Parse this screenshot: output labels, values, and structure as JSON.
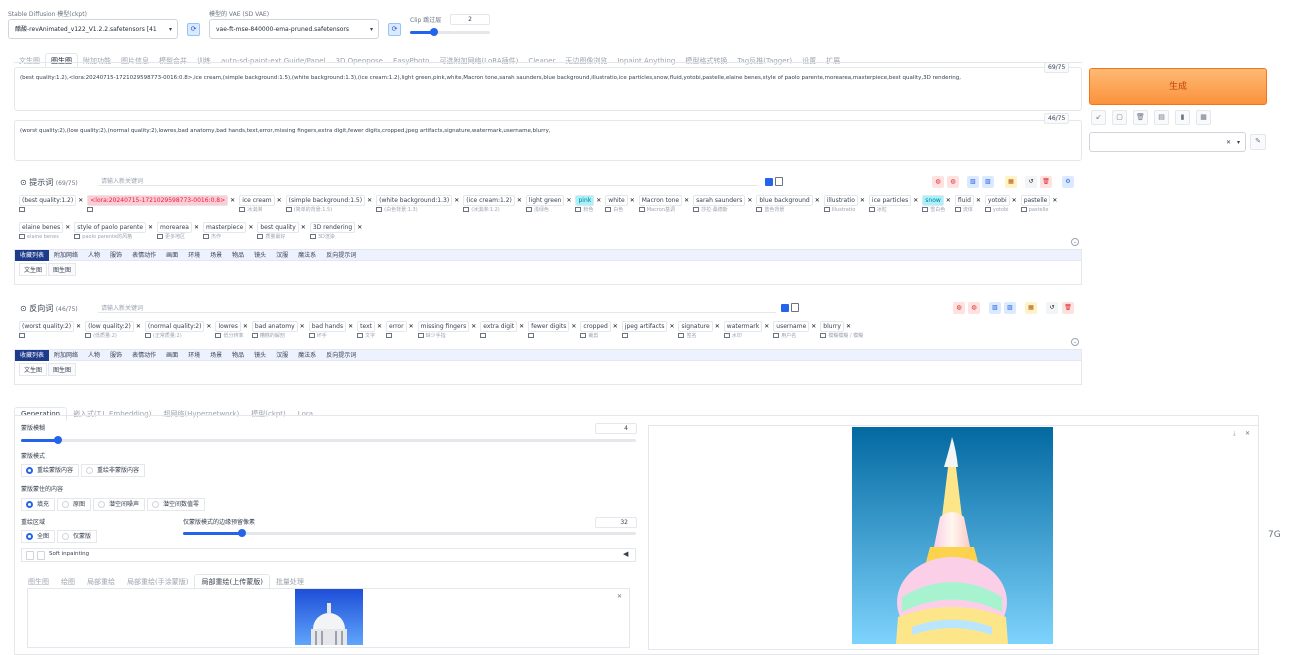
{
  "header": {
    "model_label": "Stable Diffusion 模型(ckpt)",
    "model_value": "醋酸-revAnimated_v122_V1.2.2.safetensors [41",
    "vae_label": "模型的 VAE (SD VAE)",
    "vae_value": "vae-ft-mse-840000-ema-pruned.safetensors",
    "clip_label": "Clip 跳过层",
    "clip_value": "2",
    "clip_fraction": 0.3
  },
  "tabs": [
    "文生图",
    "图生图",
    "附加功能",
    "图片信息",
    "模型合并",
    "训练",
    "auto-sd-paint-ext Guide/Panel",
    "3D Openpose",
    "EasyPhoto",
    "可选附加网络(LoRA插件)",
    "Cleaner",
    "无边图像浏览",
    "Inpaint Anything",
    "模型格式转换",
    "Tag反推(Tagger)",
    "设置",
    "扩展"
  ],
  "active_tab_index": 1,
  "prompt": {
    "text": "(best quality:1.2),<lora:20240715-1721029598773-0016:0.8>,ice cream,(simple background:1.5),(white background:1.3),(ice cream:1.2),light green,pink,white,Macron tone,sarah saunders,blue background,illustratio,ice particles,snow,fluid,yotobi,pastelle,elaine benes,style of paolo parente,morearea,masterpiece,best quality,3D rendering,",
    "count": "69/75"
  },
  "negative": {
    "text": "(worst quality:2),(low quality:2),(normal quality:2),lowres,bad anatomy,bad hands,text,error,missing fingers,extra digit,fewer digits,cropped,jpeg artifacts,signature,watermark,username,blurry,",
    "count": "46/75"
  },
  "generate_label": "生成",
  "prompt_section": {
    "title": "提示词",
    "count": "(69/75)",
    "search_placeholder": "请输入新关键词",
    "tags_row1": [
      {
        "t": "(best quality:1.2)",
        "tr": ""
      },
      {
        "t": "<lora:20240715-1721029598773-0016:0.8>",
        "tr": "",
        "cls": "pink"
      },
      {
        "t": "ice cream",
        "tr": "冰淇淋"
      },
      {
        "t": "(simple background:1.5)",
        "tr": "(简单的背景:1.5)"
      },
      {
        "t": "(white background:1.3)",
        "tr": "(白色背景:1.3)"
      },
      {
        "t": "(ice cream:1.2)",
        "tr": "(冰淇淋:1.2)"
      },
      {
        "t": "light green",
        "tr": "浅绿色"
      },
      {
        "t": "pink",
        "tr": "粉色",
        "cls": "cyan"
      },
      {
        "t": "white",
        "tr": "白色"
      },
      {
        "t": "Macron tone",
        "tr": "Macron基调"
      },
      {
        "t": "sarah saunders",
        "tr": "莎拉·桑德斯"
      },
      {
        "t": "blue background",
        "tr": "蓝色背景"
      },
      {
        "t": "illustratio",
        "tr": "Illustratio"
      },
      {
        "t": "ice particles",
        "tr": "冰粒"
      },
      {
        "t": "snow",
        "tr": "雪白色",
        "cls": "cyan"
      },
      {
        "t": "fluid",
        "tr": "流体"
      },
      {
        "t": "yotobi",
        "tr": "yotobi"
      },
      {
        "t": "pastelle",
        "tr": "pastelle"
      }
    ],
    "tags_row2": [
      {
        "t": "elaine benes",
        "tr": "elaine benes"
      },
      {
        "t": "style of paolo parente",
        "tr": "paolo parente的风格"
      },
      {
        "t": "morearea",
        "tr": "更多地区"
      },
      {
        "t": "masterpiece",
        "tr": "杰作"
      },
      {
        "t": "best quality",
        "tr": "质量最好"
      },
      {
        "t": "3D rendering",
        "tr": "3D渲染"
      }
    ]
  },
  "categories": [
    "收藏列表",
    "附加网络",
    "人物",
    "服饰",
    "表情动作",
    "画面",
    "环境",
    "场景",
    "物品",
    "镜头",
    "汉服",
    "魔法系",
    "反向提示词"
  ],
  "sub_tabs": [
    "文生图",
    "图生图"
  ],
  "neg_section": {
    "title": "反向词",
    "count": "(46/75)",
    "search_placeholder": "请输入新关键词",
    "tags": [
      {
        "t": "(worst quality:2)",
        "tr": ""
      },
      {
        "t": "(low quality:2)",
        "tr": "(低质量:2)"
      },
      {
        "t": "(normal quality:2)",
        "tr": "(正常质量:2)"
      },
      {
        "t": "lowres",
        "tr": "低分辨率"
      },
      {
        "t": "bad anatomy",
        "tr": "糟糕的解剖"
      },
      {
        "t": "bad hands",
        "tr": "坏手"
      },
      {
        "t": "text",
        "tr": "文字"
      },
      {
        "t": "error",
        "tr": ""
      },
      {
        "t": "missing fingers",
        "tr": "缺少手指"
      },
      {
        "t": "extra digit",
        "tr": ""
      },
      {
        "t": "fewer digits",
        "tr": ""
      },
      {
        "t": "cropped",
        "tr": "裁剪"
      },
      {
        "t": "jpeg artifacts",
        "tr": ""
      },
      {
        "t": "signature",
        "tr": "签名"
      },
      {
        "t": "watermark",
        "tr": "水印"
      },
      {
        "t": "username",
        "tr": "用户名"
      },
      {
        "t": "blurry",
        "tr": "模糊模糊 / 模糊"
      }
    ]
  },
  "bottom_tabs": [
    "Generation",
    "嵌入式(T.I. Embedding)",
    "超网络(Hypernetwork)",
    "模型(ckpt)",
    "Lora"
  ],
  "mask_blur": {
    "label": "蒙版模糊",
    "value": "4",
    "fraction": 0.06
  },
  "mask_mode": {
    "label": "蒙版模式",
    "options": [
      "重绘蒙版内容",
      "重绘非蒙版内容"
    ],
    "selected": 0
  },
  "masked_content": {
    "label": "蒙版蒙住的内容",
    "options": [
      "填充",
      "原图",
      "潜空间噪声",
      "潜空间数值零"
    ],
    "selected": 0
  },
  "inpaint_area": {
    "label": "重绘区域",
    "options": [
      "全图",
      "仅蒙版"
    ],
    "selected": 0
  },
  "padding": {
    "label": "仅蒙版模式的边缘预留像素",
    "value": "32",
    "fraction": 0.13
  },
  "soft_inpaint_label": "Soft inpainting",
  "img_tabs": [
    "图生图",
    "绘图",
    "局部重绘",
    "局部重绘(手涂蒙版)",
    "局部重绘(上传蒙版)",
    "批量处理"
  ],
  "img_tabs_active": 4,
  "right_edge_label": "7G"
}
